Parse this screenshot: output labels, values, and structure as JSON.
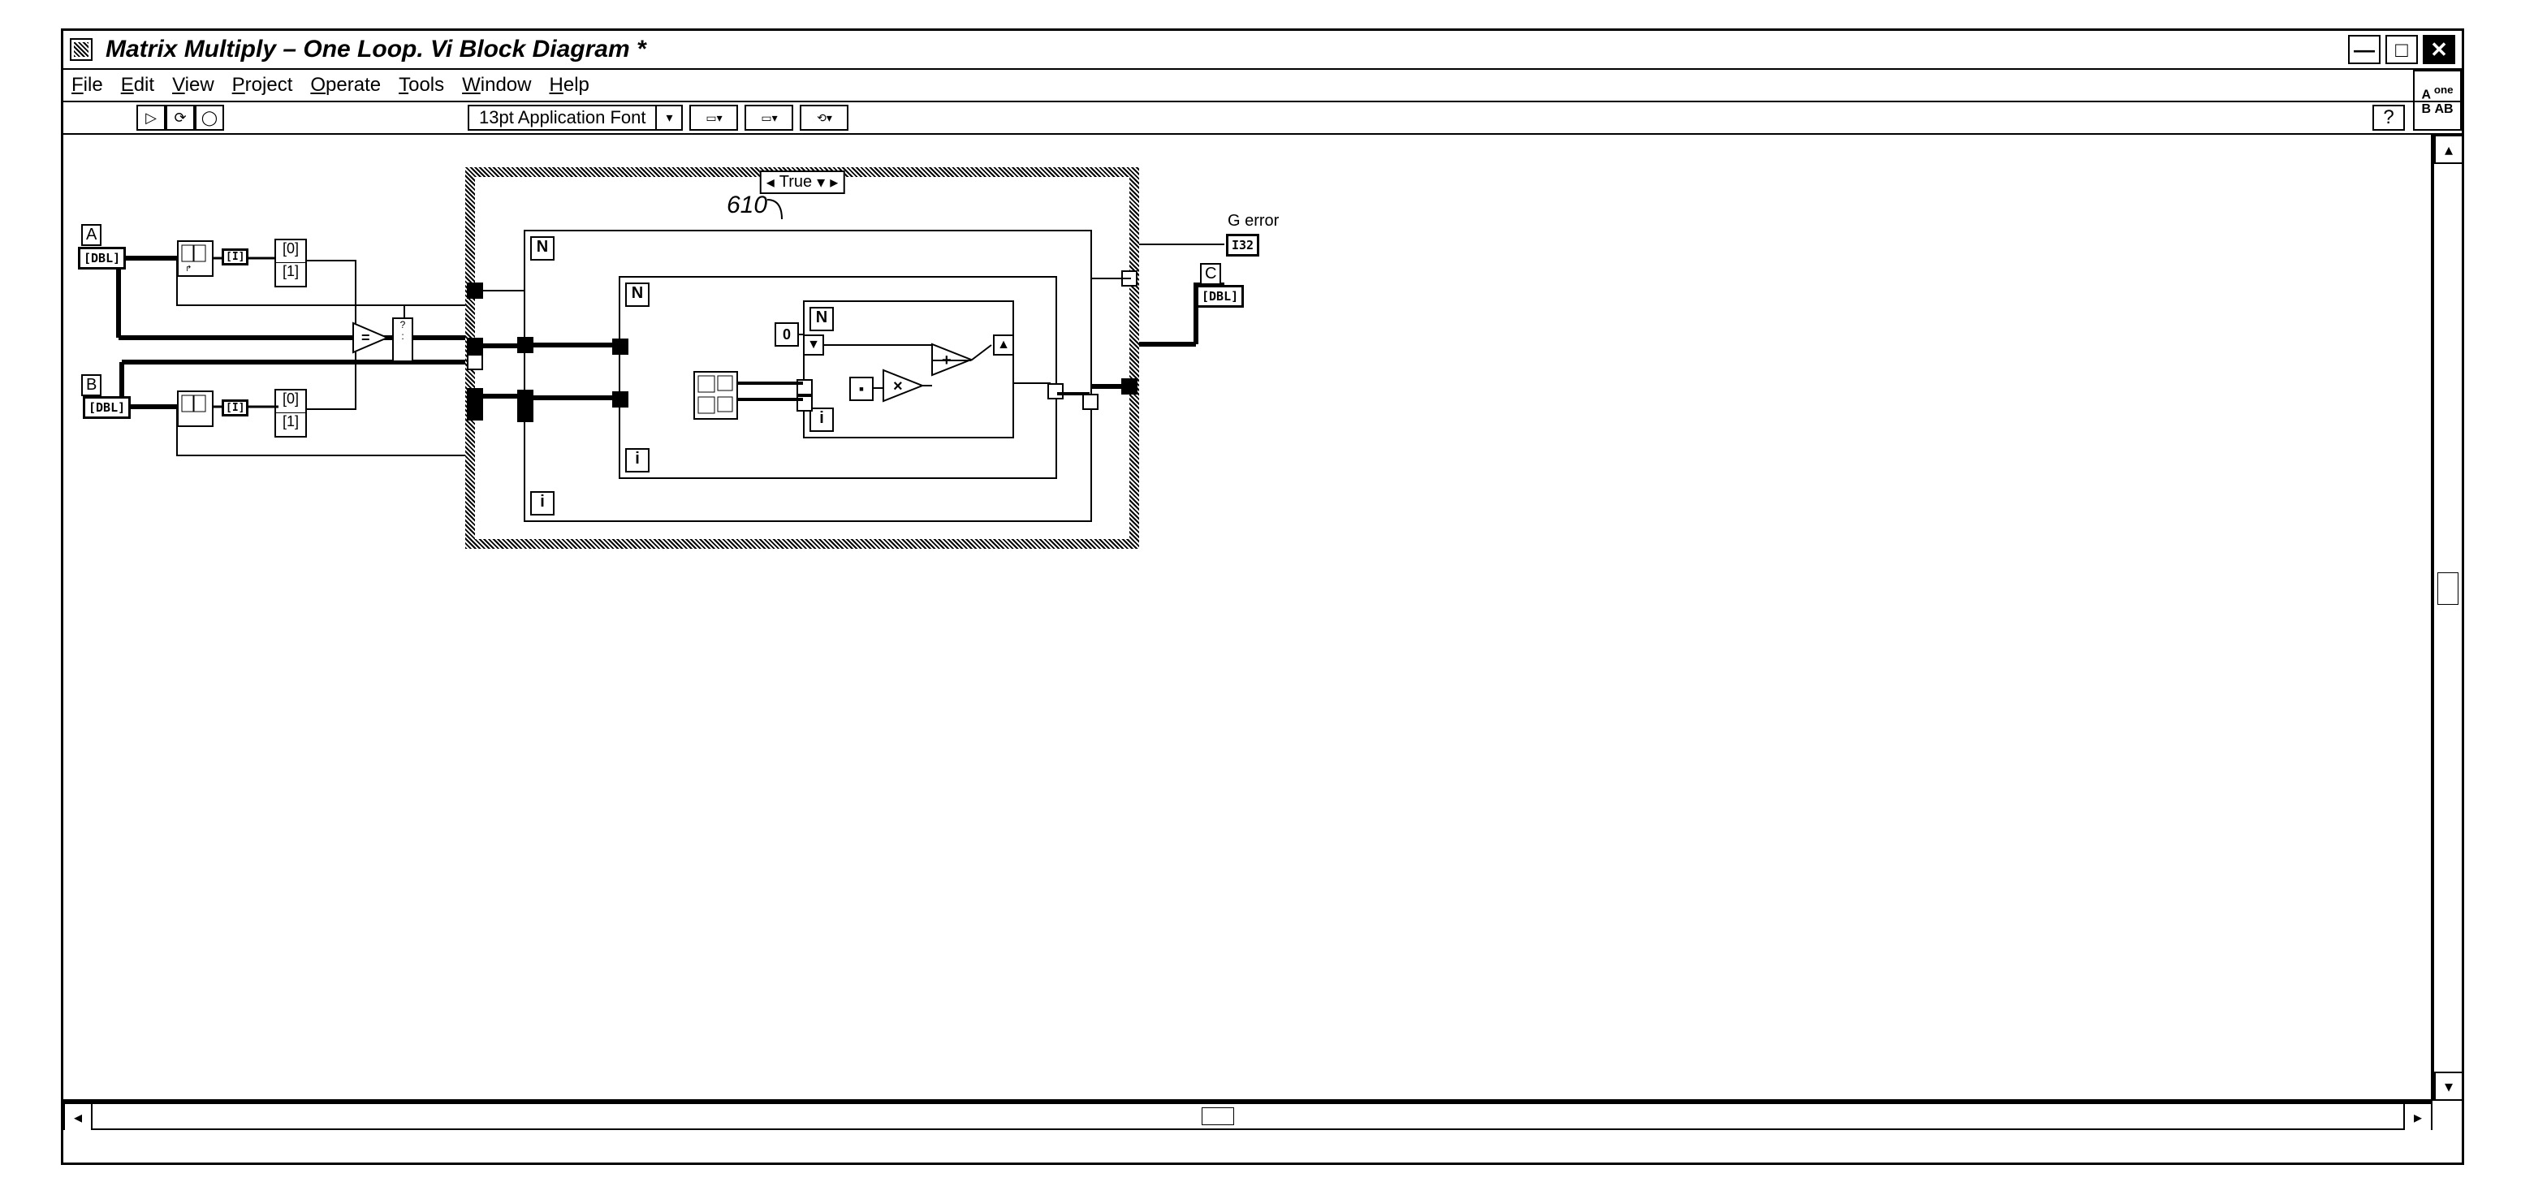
{
  "window": {
    "title": "Matrix Multiply – One Loop. Vi Block Diagram *"
  },
  "menu": {
    "file": "File",
    "edit": "Edit",
    "view": "View",
    "project": "Project",
    "operate": "Operate",
    "tools": "Tools",
    "window": "Window",
    "help": "Help"
  },
  "toolbar": {
    "font": "13pt Application Font"
  },
  "icon_palette": "AB",
  "diagram": {
    "annotation_ref": "610",
    "input_A": {
      "label": "A",
      "type": "[DBL]"
    },
    "input_B": {
      "label": "B",
      "type": "[DBL]"
    },
    "output_C": {
      "label": "C",
      "type": "[DBL]"
    },
    "output_error": {
      "label": "G error",
      "type": "I32"
    },
    "index_0": "[0]",
    "index_1": "[1]",
    "case_selector": "True",
    "loop_N": "N",
    "loop_i": "i",
    "zero_const": "0"
  }
}
